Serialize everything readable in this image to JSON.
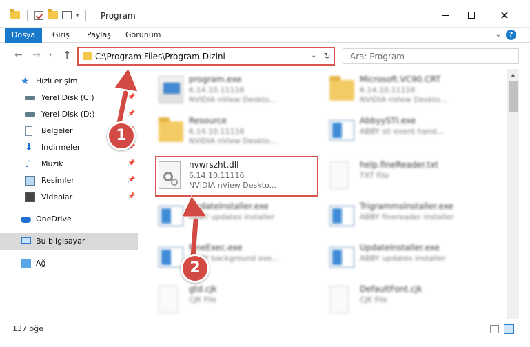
{
  "window": {
    "title": "Program",
    "controls": {
      "minimize": "—",
      "maximize": "☐",
      "close": "✕"
    }
  },
  "ribbon": {
    "tabs": [
      {
        "label": "Dosya"
      },
      {
        "label": "Giriş"
      },
      {
        "label": "Paylaş"
      },
      {
        "label": "Görünüm"
      }
    ],
    "help": "?"
  },
  "nav": {
    "back": "←",
    "forward": "→",
    "recent": "▾",
    "up": "↑",
    "address": "C:\\Program Files\\Program Dizini",
    "address_dropdown": "⌄",
    "refresh": "↻",
    "search_placeholder": "Ara: Program"
  },
  "sidebar": {
    "quick_access": "Hızlı erişim",
    "items": [
      {
        "label": "Yerel Disk (C:)",
        "icon": "drive-icon",
        "pin": "📌"
      },
      {
        "label": "Yerel Disk (D:)",
        "icon": "drive-icon",
        "pin": "📌"
      },
      {
        "label": "Belgeler",
        "icon": "documents-icon",
        "pin": "📌"
      },
      {
        "label": "İndirmeler",
        "icon": "downloads-icon",
        "pin": "📌"
      },
      {
        "label": "Müzik",
        "icon": "music-icon",
        "pin": "📌"
      },
      {
        "label": "Resimler",
        "icon": "pictures-icon",
        "pin": "📌"
      },
      {
        "label": "Videolar",
        "icon": "videos-icon",
        "pin": "📌"
      }
    ],
    "onedrive": "OneDrive",
    "this_pc": "Bu bilgisayar",
    "network": "Ağ"
  },
  "files": [
    {
      "name": "program.exe",
      "line1": "6.14.10.11116",
      "line2": "NVIDIA nView Deskto...",
      "icon": "exe-icon"
    },
    {
      "name": "Microsoft.VC90.CRT",
      "line1": "6.14.10.11116",
      "line2": "NVIDIA nView Deskto...",
      "icon": "folder-icon"
    },
    {
      "name": "Resource",
      "line1": "6.14.10.11116",
      "line2": "NVIDIA nView Deskto...",
      "icon": "folder-icon"
    },
    {
      "name": "AbbyySTI.exe",
      "line1": "ABBY sti event hand...",
      "line2": "",
      "icon": "app-window-icon"
    },
    {
      "name": "nvwrszht.dll",
      "line1": "6.14.10.11116",
      "line2": "NVIDIA nView Deskto...",
      "icon": "dll-gear-icon"
    },
    {
      "name": "help.fineReader.txt",
      "line1": "TXT File",
      "line2": "",
      "icon": "text-file-icon"
    },
    {
      "name": "UpdateInstaller.exe",
      "line1": "ABBY updates installer",
      "line2": "",
      "icon": "app-window-icon"
    },
    {
      "name": "TrigrammsInstaller.exe",
      "line1": "ABBY finereader installer",
      "line2": "",
      "icon": "app-window-icon"
    },
    {
      "name": "FineExec.exe",
      "line1": "ABBY background exe...",
      "line2": "",
      "icon": "app-window-icon"
    },
    {
      "name": "UpdateInstaller.exe",
      "line1": "ABBY updates installer",
      "line2": "",
      "icon": "app-window-icon"
    },
    {
      "name": "gtd.cjk",
      "line1": "CJK File",
      "line2": "",
      "icon": "file-icon"
    },
    {
      "name": "DefaultFont.cjk",
      "line1": "CJK File",
      "line2": "",
      "icon": "file-icon"
    }
  ],
  "annotations": {
    "step1": "1",
    "step2": "2"
  },
  "status": {
    "item_count": "137 öğe"
  },
  "colors": {
    "accent": "#1979ca",
    "annotation": "#d24a43",
    "highlight_border": "#d9534f"
  }
}
